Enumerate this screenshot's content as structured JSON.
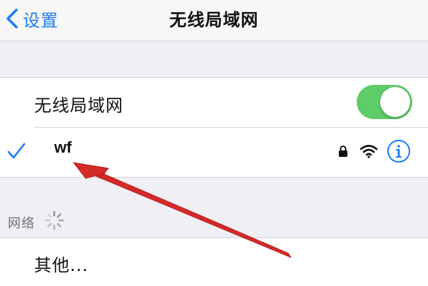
{
  "navbar": {
    "back_label": "设置",
    "title": "无线局域网"
  },
  "wifi_toggle": {
    "label": "无线局域网",
    "on": true
  },
  "connected_network": {
    "name": "wf",
    "secured": true,
    "selected": true
  },
  "networks_section": {
    "header": "网络"
  },
  "other_item": {
    "label": "其他..."
  },
  "colors": {
    "accent": "#1b7cf5",
    "toggle_on": "#5fcc6a",
    "annotation_arrow": "#d42a2a",
    "background": "#efeff4"
  },
  "icons": [
    "chevron-left-icon",
    "checkmark-icon",
    "lock-icon",
    "wifi-icon",
    "info-icon",
    "spinner-icon",
    "annotation-arrow-icon"
  ]
}
